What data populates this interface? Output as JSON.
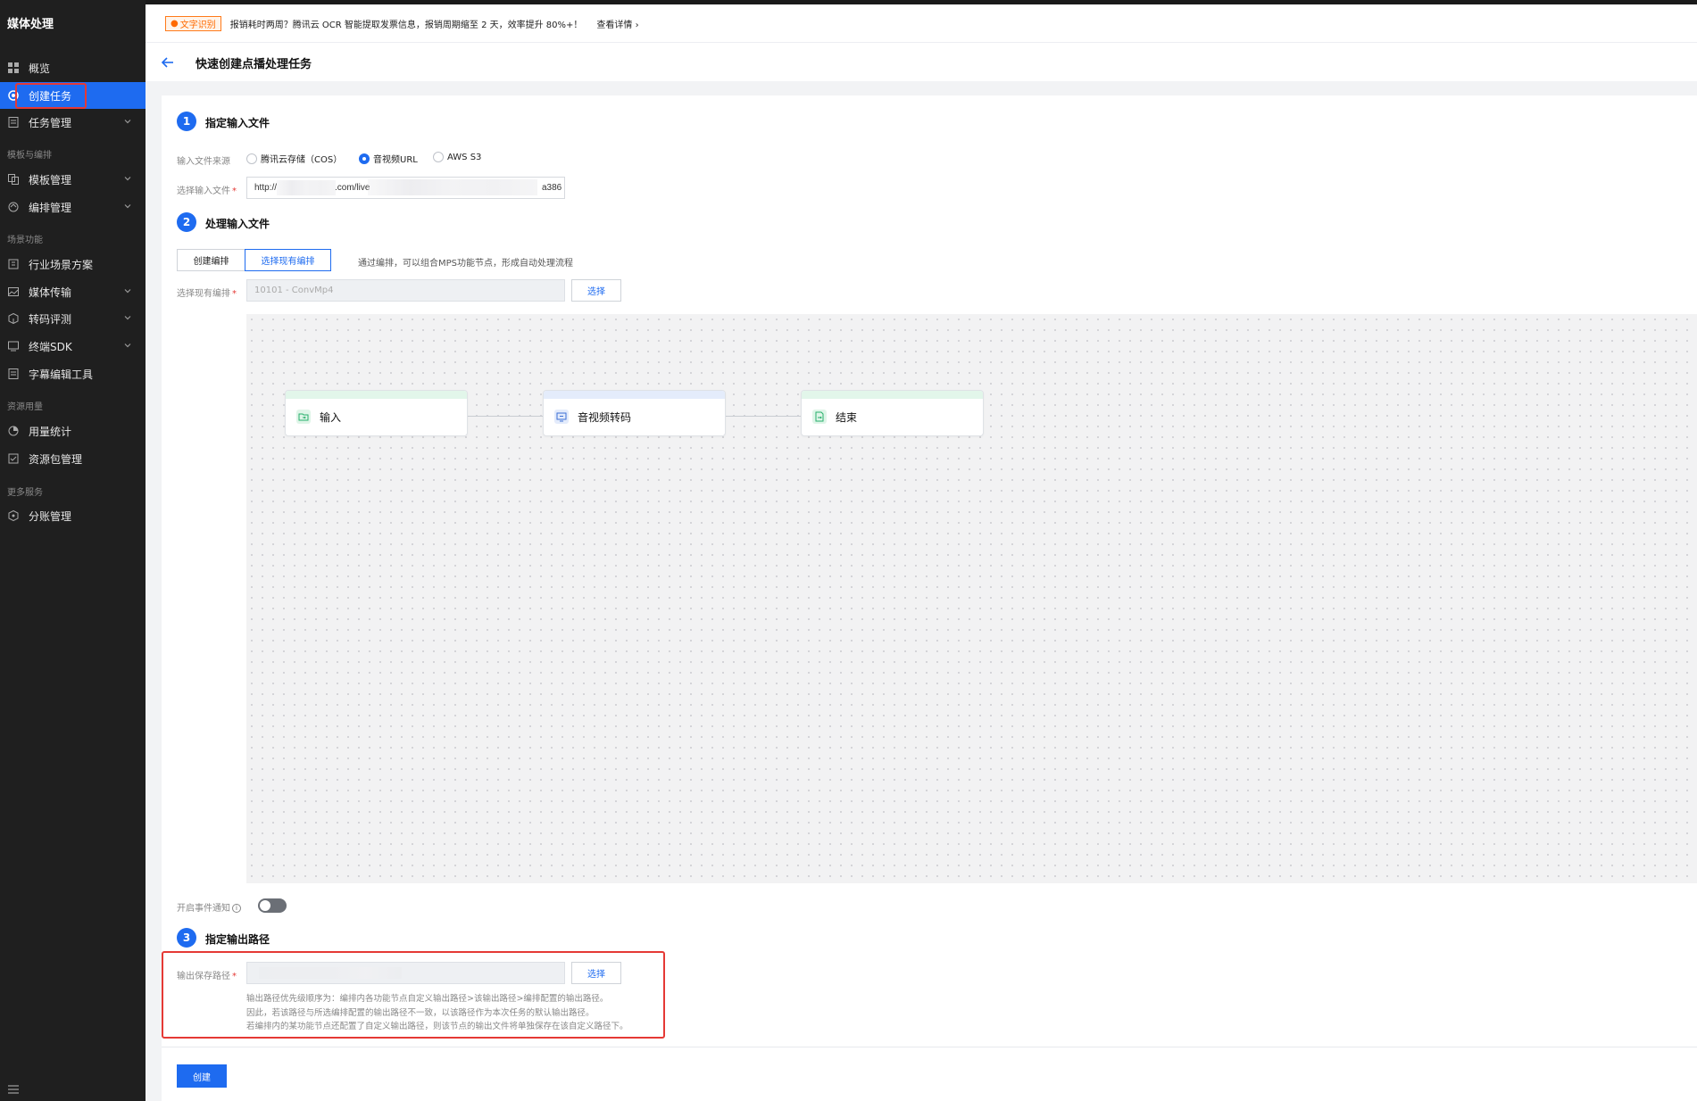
{
  "sidebar": {
    "title": "媒体处理",
    "items": [
      {
        "label": "概览",
        "icon": "grid-icon"
      },
      {
        "label": "创建任务",
        "icon": "target-icon",
        "active": true
      },
      {
        "label": "任务管理",
        "icon": "doc-icon",
        "chevron": true
      }
    ],
    "section_template": "模板与编排",
    "template_items": [
      {
        "label": "模板管理",
        "chevron": true
      },
      {
        "label": "编排管理",
        "chevron": true
      }
    ],
    "section_scene": "场景功能",
    "scene_items": [
      {
        "label": "行业场景方案",
        "chevron": false
      },
      {
        "label": "媒体传输",
        "chevron": true
      },
      {
        "label": "转码评测",
        "chevron": true
      },
      {
        "label": "终端SDK",
        "chevron": true
      },
      {
        "label": "字幕编辑工具",
        "chevron": false
      }
    ],
    "section_usage": "资源用量",
    "usage_items": [
      {
        "label": "用量统计"
      },
      {
        "label": "资源包管理"
      }
    ],
    "section_more": "更多服务",
    "more_items": [
      {
        "label": "分账管理"
      }
    ]
  },
  "banner": {
    "tag": "文字识别",
    "text": "报销耗时两周？腾讯云 OCR 智能提取发票信息，报销周期缩至 2 天，效率提升 80%+！",
    "link": "查看详情"
  },
  "header": {
    "title": "快速创建点播处理任务"
  },
  "step1": {
    "number": "1",
    "title": "指定输入文件",
    "source_label": "输入文件来源",
    "options": [
      "腾讯云存储（COS）",
      "音视频URL",
      "AWS S3"
    ],
    "selected": "音视频URL",
    "file_label": "选择输入文件",
    "file_value_start": "http://",
    "file_value_mid": ".com/live",
    "file_value_end": "a386"
  },
  "step2": {
    "number": "2",
    "title": "处理输入文件",
    "tab_create": "创建编排",
    "tab_select": "选择现有编排",
    "hint": "通过编排，可以组合MPS功能节点，形成自动处理流程",
    "select_label": "选择现有编排",
    "select_value": "10101 - ConvMp4",
    "select_button": "选择",
    "nodes": [
      {
        "label": "输入",
        "color": "#27b06b",
        "bar": "#e2f6ea"
      },
      {
        "label": "音视频转码",
        "color": "#3b6fd6",
        "bar": "#e4ecfb"
      },
      {
        "label": "结束",
        "color": "#27b06b",
        "bar": "#e2f6ea"
      }
    ]
  },
  "event_notify": {
    "label": "开启事件通知",
    "enabled": false
  },
  "step3": {
    "number": "3",
    "title": "指定输出路径",
    "path_label": "输出保存路径",
    "select_button": "选择",
    "notes": [
      "输出路径优先级顺序为：编排内各功能节点自定义输出路径>该输出路径>编排配置的输出路径。",
      "因此，若该路径与所选编排配置的输出路径不一致，以该路径作为本次任务的默认输出路径。",
      "若编排内的某功能节点还配置了自定义输出路径，则该节点的输出文件将单独保存在该自定义路径下。"
    ]
  },
  "submit": {
    "label": "创建"
  }
}
